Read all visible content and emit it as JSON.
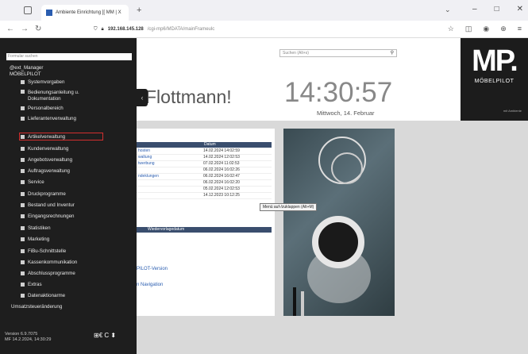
{
  "browser": {
    "tab_title": "Ambiente Einrichtung ][ MM | X",
    "url_host": "192.168.145.128",
    "url_path": "/cgi-mp6/MDATA/mainFrameulc",
    "window_controls": [
      "–",
      "□",
      "✕"
    ]
  },
  "sidebar": {
    "search_placeholder": "Formular suchen",
    "root": "@ext_Manager",
    "root2": "MÖBELPILOT",
    "items": [
      {
        "label": "Systemvorgaben",
        "icon": "gear-icon"
      },
      {
        "label": "Bedienungsanleitung u.",
        "label2": "Dokumentation",
        "icon": "book-icon"
      },
      {
        "label": "Personalbereich",
        "icon": "person-icon"
      },
      {
        "label": "Lieferantenverwaltung",
        "icon": "truck-icon"
      },
      {
        "label": "Artikelverwaltung",
        "icon": "tag-icon"
      },
      {
        "label": "Kundenverwaltung",
        "icon": "people-icon"
      },
      {
        "label": "Angebotsverwaltung",
        "icon": "document-icon"
      },
      {
        "label": "Auftragsverwaltung",
        "icon": "document-icon"
      },
      {
        "label": "Service",
        "icon": "wrench-icon"
      },
      {
        "label": "Druckprogramme",
        "icon": "printer-icon"
      },
      {
        "label": "Bestand und Inventur",
        "icon": "box-icon"
      },
      {
        "label": "Eingangsrechnungen",
        "icon": "invoice-icon"
      },
      {
        "label": "Statistiken",
        "icon": "chart-icon"
      },
      {
        "label": "Marketing",
        "icon": "megaphone-icon"
      },
      {
        "label": "FiBu-Schnittstelle",
        "icon": "money-icon"
      },
      {
        "label": "Kassenkommunikation",
        "icon": "register-icon"
      },
      {
        "label": "Abschlussprogramme",
        "icon": "flag-icon"
      },
      {
        "label": "Extras",
        "icon": "star-icon"
      },
      {
        "label": "Datenaktionarme",
        "icon": "database-icon"
      },
      {
        "label": "Umsatzsteueränderung",
        "icon": ""
      }
    ],
    "version_line1": "Version 6.9.7075",
    "version_line2": "MF 14.2.2024, 14:30:29",
    "footer_icons": "⊞€ C ⬍"
  },
  "main": {
    "search_placeholder": "Suchen (Alt+s)",
    "greeting": "Flottmann!",
    "clock": "14:30:57",
    "date": "Mittwoch, 14. Februar",
    "logo_text": "MP.",
    "logo_sub": "MÖBELPILOT",
    "logo_tiny": "mit Ambiente",
    "tooltip": "Menü auf-/zuklappen (Alt+M)",
    "widget": {
      "col_date": "Datum",
      "rows": [
        {
          "name": "hosten",
          "date": "14.02.2024 14:02:59"
        },
        {
          "name": "waltung",
          "date": "14.02.2024 12:02:53"
        },
        {
          "name": "twerbung",
          "date": "07.02.2024 11:02:53"
        },
        {
          "name": "",
          "date": "06.02.2024 16:02:26"
        },
        {
          "name": "ndeklungen",
          "date": "06.02.2024 16:02:47"
        },
        {
          "name": "",
          "date": "06.02.2024 16:02:20"
        },
        {
          "name": "",
          "date": "05.02.2024 12:02:53"
        },
        {
          "name": "",
          "date": "14.12.2023 10:12:25"
        }
      ],
      "col_wiedervorlage": "Wiedervorlagedatum",
      "link1": "PILOT-Version",
      "link2": "n Navigation"
    }
  }
}
